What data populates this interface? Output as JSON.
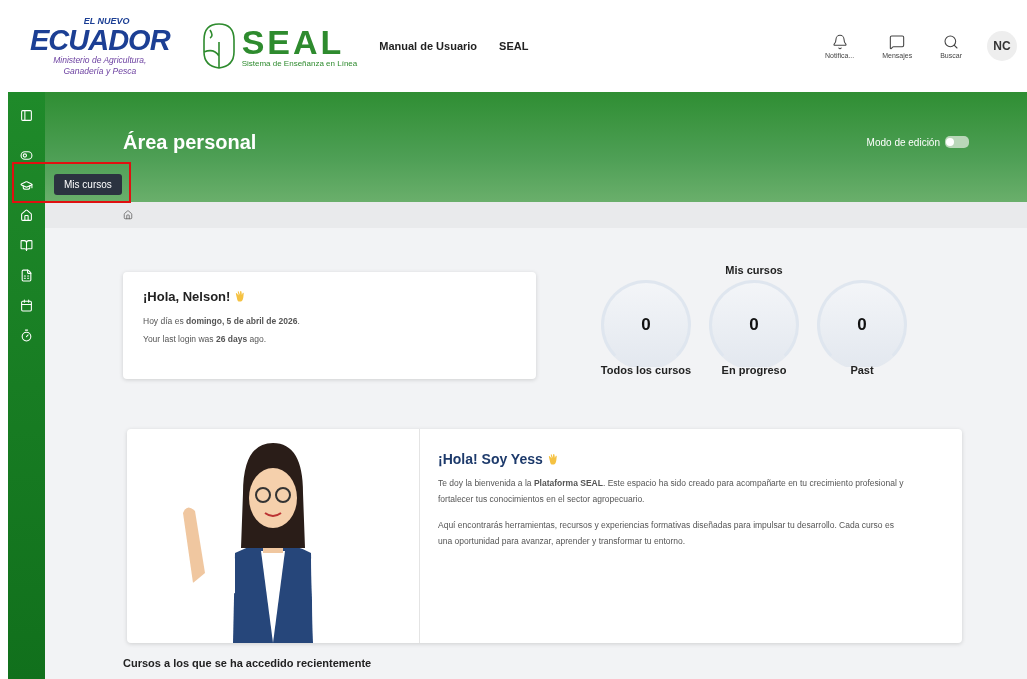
{
  "header": {
    "ministry_logo": {
      "tagline": "EL NUEVO",
      "name": "ECUADOR",
      "subtitle": "Ministerio de Agricultura, Ganadería y Pesca"
    },
    "seal_logo": {
      "name": "SEAL",
      "subtitle": "Sistema de Enseñanza en Línea"
    },
    "nav_links": [
      "Manual de Usuario",
      "SEAL"
    ],
    "actions": [
      {
        "kind": "bell",
        "label": "Notifica..."
      },
      {
        "kind": "chat",
        "label": "Mensajes"
      },
      {
        "kind": "search",
        "label": "Buscar"
      }
    ],
    "avatar": "NC"
  },
  "sidebar": {
    "items": [
      {
        "kind": "panel",
        "highlighted": false
      },
      {
        "kind": "toggle",
        "highlighted": false
      },
      {
        "kind": "cap",
        "highlighted": true,
        "tooltip": "Mis cursos"
      },
      {
        "kind": "home",
        "highlighted": false
      },
      {
        "kind": "book",
        "highlighted": false
      },
      {
        "kind": "grades",
        "highlighted": false
      },
      {
        "kind": "calendar",
        "highlighted": false
      },
      {
        "kind": "timer",
        "highlighted": false
      }
    ]
  },
  "banner": {
    "title": "Área personal",
    "edit_mode": {
      "label": "Modo de edición",
      "on": false
    }
  },
  "greeting": {
    "title": "¡Hola, Nelson!",
    "lines": [
      "Hoy día es **domingo, 5 de abril de 2026**.",
      "Your last login was **26 days** ago."
    ]
  },
  "my_courses": {
    "title": "Mis cursos",
    "stats": [
      {
        "value": "0",
        "label": "Todos los cursos"
      },
      {
        "value": "0",
        "label": "En progreso"
      },
      {
        "value": "0",
        "label": "Past"
      }
    ]
  },
  "welcome": {
    "title": "¡Hola! Soy Yess",
    "paragraphs": [
      "Te doy la bienvenida a la **Plataforma SEAL**. Este espacio ha sido creado para acompañarte en tu crecimiento profesional y fortalecer tus conocimientos en el sector agropecuario.",
      "Aquí encontrarás herramientas, recursos y experiencias formativas diseñadas para impulsar tu desarrollo. Cada curso es una oportunidad para avanzar, aprender y transformar tu entorno."
    ]
  },
  "recent": {
    "title": "Cursos a los que se ha accedido recientemente"
  }
}
